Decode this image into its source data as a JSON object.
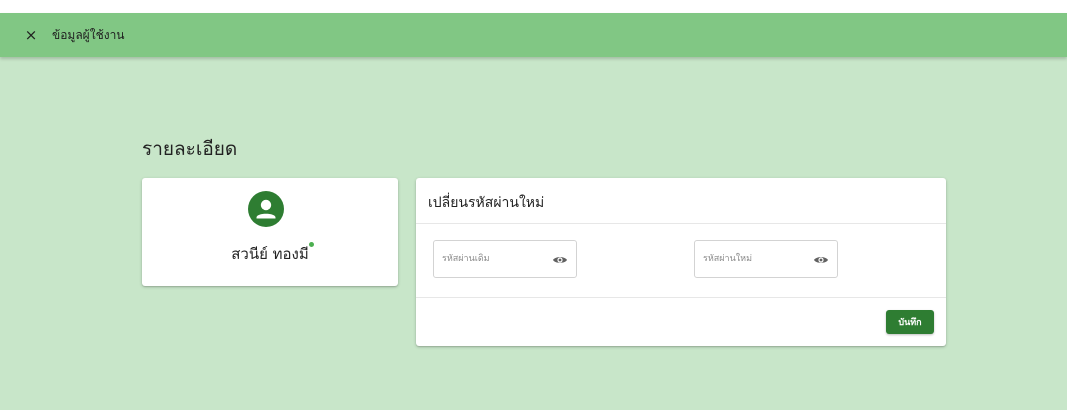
{
  "dialog": {
    "title": "ข้อมูลผู้ใช้งาน",
    "close_label": "×"
  },
  "section": {
    "title": "รายละเอียด"
  },
  "profile": {
    "name": "สวนีย์ ทองมี",
    "avatar_icon": "person-icon",
    "status_color": "#4caf50"
  },
  "password_change": {
    "title": "เปลี่ยนรหัสผ่านใหม่",
    "old_password": {
      "placeholder": "รหัสผ่านเดิม",
      "value": ""
    },
    "new_password": {
      "placeholder": "รหัสผ่านใหม่",
      "value": ""
    },
    "save_label": "บันทึก"
  },
  "colors": {
    "topbar": "#81c784",
    "background": "#c8e6c9",
    "accent": "#2e7d32"
  }
}
